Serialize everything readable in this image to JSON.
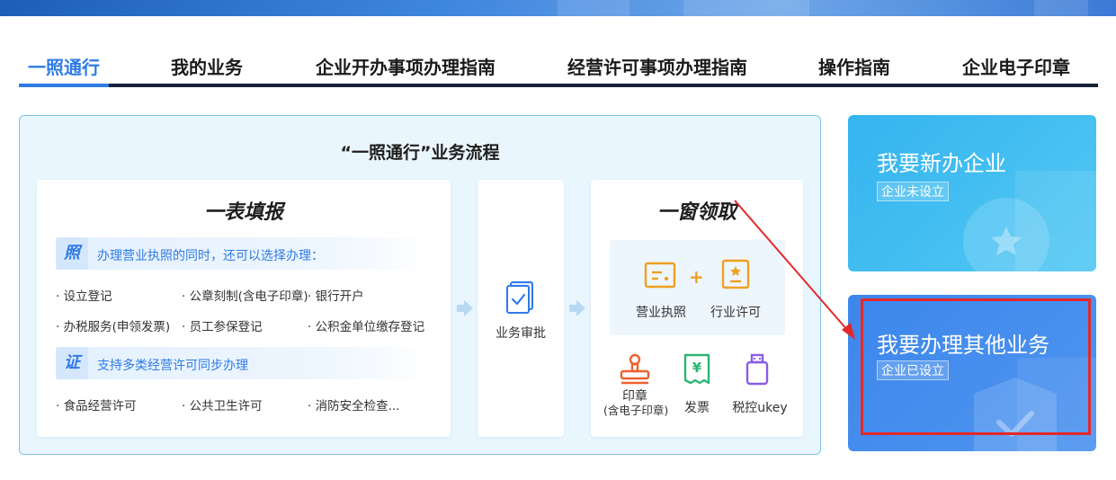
{
  "tabs": [
    {
      "label": "一照通行",
      "active": true
    },
    {
      "label": "我的业务"
    },
    {
      "label": "企业开办事项办理指南"
    },
    {
      "label": "经营许可事项办理指南"
    },
    {
      "label": "操作指南"
    },
    {
      "label": "企业电子印章"
    }
  ],
  "flow": {
    "title": "“一照通行”业务流程",
    "fill": {
      "title": "一表填报",
      "license_badge": "照",
      "license_text": "办理营业执照的同时，还可以选择办理：",
      "license_items": [
        "设立登记",
        "公章刻制(含电子印章)",
        "银行开户",
        "办税服务(申领发票)",
        "员工参保登记",
        "公积金单位缴存登记"
      ],
      "permit_badge": "证",
      "permit_text": "支持多类经营许可同步办理",
      "permit_items": [
        "食品经营许可",
        "公共卫生许可",
        "消防安全检查..."
      ]
    },
    "review": {
      "label": "业务审批"
    },
    "collect": {
      "title": "一窗领取",
      "license": "营业执照",
      "permit": "行业许可",
      "plus": "+",
      "seal_line1": "印章",
      "seal_line2": "(含电子印章)",
      "invoice": "发票",
      "ukey": "税控ukey"
    }
  },
  "side": {
    "new_title": "我要新办企业",
    "new_badge": "企业未设立",
    "other_title": "我要办理其他业务",
    "other_badge": "企业已设立"
  },
  "colors": {
    "accent": "#2f7be6",
    "annotation": "#e4282a",
    "card_new": "#40bdf1",
    "card_other": "#458cee"
  }
}
